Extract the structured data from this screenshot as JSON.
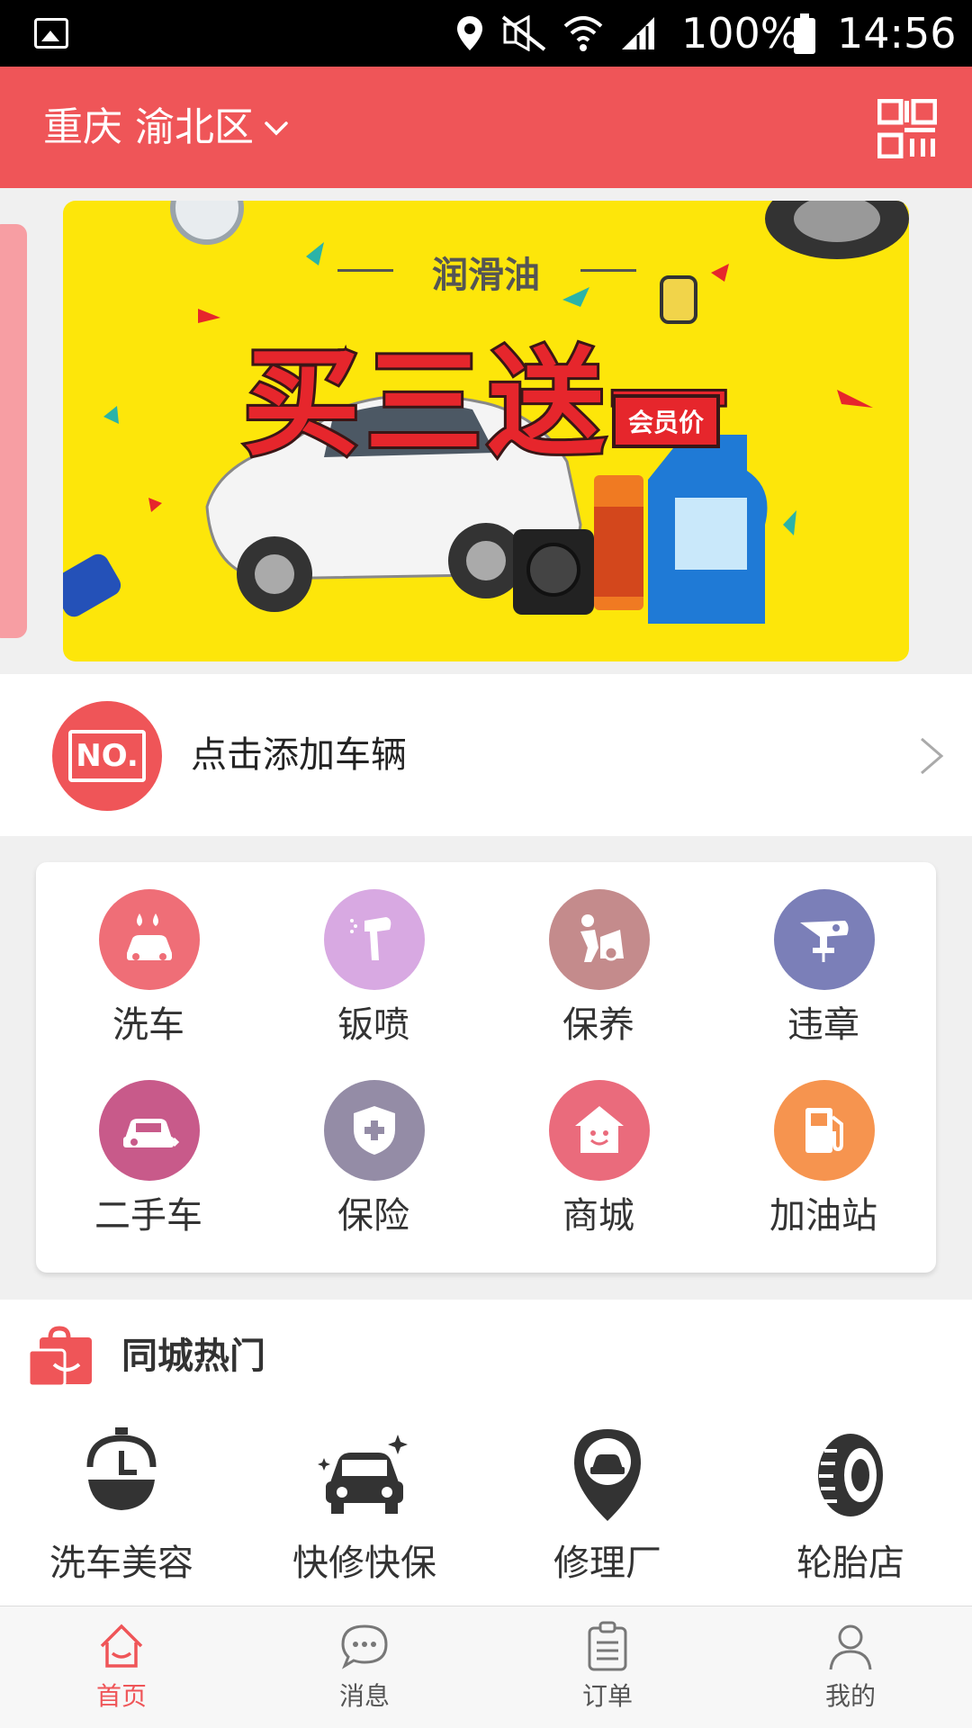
{
  "status_bar": {
    "battery": "100%",
    "time": "14:56"
  },
  "header": {
    "city": "重庆 渝北区"
  },
  "banner": {
    "subtitle": "润滑油",
    "title": "买三送一",
    "tag": "会员价"
  },
  "vehicle": {
    "badge": "NO.",
    "label": "点击添加车辆"
  },
  "services": [
    {
      "label": "洗车",
      "color": "#ef6e77",
      "icon": "car-wash-icon"
    },
    {
      "label": "钣喷",
      "color": "#d8a9e2",
      "icon": "spray-gun-icon"
    },
    {
      "label": "保养",
      "color": "#c48b8c",
      "icon": "maintenance-icon"
    },
    {
      "label": "违章",
      "color": "#7b7fb8",
      "icon": "traffic-camera-icon"
    },
    {
      "label": "二手车",
      "color": "#c85a8a",
      "icon": "used-car-icon"
    },
    {
      "label": "保险",
      "color": "#948ca6",
      "icon": "shield-plus-icon"
    },
    {
      "label": "商城",
      "color": "#ea6b7c",
      "icon": "shop-house-icon"
    },
    {
      "label": "加油站",
      "color": "#f6944f",
      "icon": "fuel-pump-icon"
    }
  ],
  "hot": {
    "title": "同城热门",
    "items": [
      {
        "label": "洗车美容",
        "icon": "clock-bucket-icon"
      },
      {
        "label": "快修快保",
        "icon": "sparkle-car-icon"
      },
      {
        "label": "修理厂",
        "icon": "location-pin-car-icon"
      },
      {
        "label": "轮胎店",
        "icon": "tire-icon"
      }
    ]
  },
  "tabs": [
    {
      "label": "首页",
      "icon": "home-icon",
      "active": true
    },
    {
      "label": "消息",
      "icon": "chat-bubble-icon",
      "active": false
    },
    {
      "label": "订单",
      "icon": "clipboard-icon",
      "active": false
    },
    {
      "label": "我的",
      "icon": "person-icon",
      "active": false
    }
  ],
  "colors": {
    "brand": "#ef5558",
    "banner_bg": "#fde60a",
    "tab_active": "#ef5558"
  }
}
